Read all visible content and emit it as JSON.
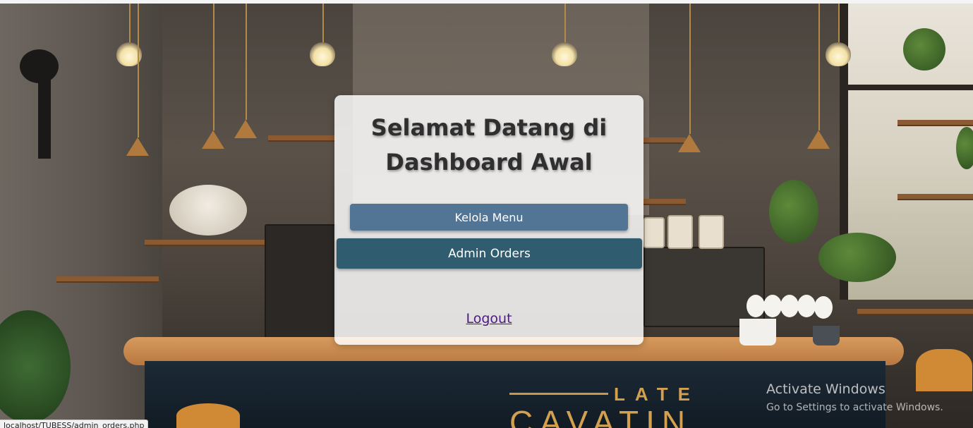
{
  "card": {
    "title_line1": "Selamat Datang di",
    "title_line2": "Dashboard Awal",
    "kelola_menu_label": "Kelola Menu",
    "admin_orders_label": "Admin Orders",
    "logout_label": "Logout"
  },
  "background": {
    "sign_top": "LATE",
    "sign_bottom": "CAVATIN"
  },
  "os": {
    "activate_title": "Activate Windows",
    "activate_sub": "Go to Settings to activate Windows.",
    "status_url": "localhost/TUBESS/admin_orders.php"
  },
  "colors": {
    "kelola_menu_button": "#527595",
    "admin_orders_button": "#305c6f",
    "logout_link": "#4b1a83",
    "card_background": "rgba(255,255,255,0.84)"
  }
}
